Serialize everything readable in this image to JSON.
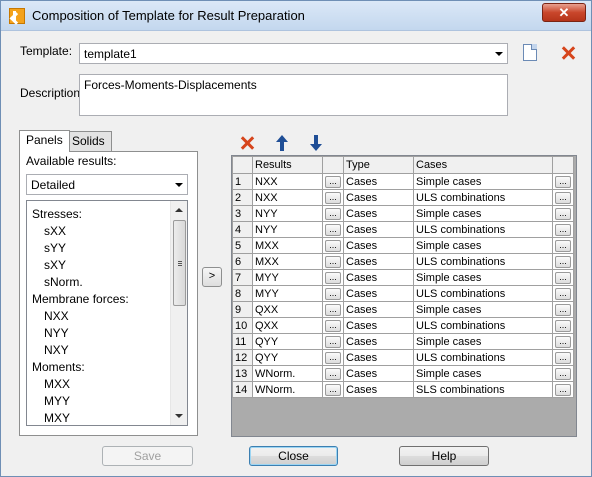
{
  "window": {
    "title": "Composition of Template for Result Preparation",
    "close_label": "✕"
  },
  "template": {
    "label": "Template:",
    "value": "template1"
  },
  "description": {
    "label": "Description:",
    "value": "Forces-Moments-Displacements"
  },
  "tabs": [
    {
      "label": "Panels",
      "active": true
    },
    {
      "label": "Solids",
      "active": false
    }
  ],
  "available": {
    "label": "Available results:",
    "filter_value": "Detailed",
    "items": [
      {
        "text": "Stresses:",
        "indent": 0
      },
      {
        "text": "sXX",
        "indent": 1
      },
      {
        "text": "sYY",
        "indent": 1
      },
      {
        "text": "sXY",
        "indent": 1
      },
      {
        "text": "sNorm.",
        "indent": 1
      },
      {
        "text": "Membrane forces:",
        "indent": 0
      },
      {
        "text": "NXX",
        "indent": 1
      },
      {
        "text": "NYY",
        "indent": 1
      },
      {
        "text": "NXY",
        "indent": 1
      },
      {
        "text": "Moments:",
        "indent": 0
      },
      {
        "text": "MXX",
        "indent": 1
      },
      {
        "text": "MYY",
        "indent": 1
      },
      {
        "text": "MXY",
        "indent": 1
      }
    ]
  },
  "move_button": {
    "label": ">"
  },
  "grid": {
    "headers": [
      "Results",
      "Type",
      "Cases"
    ],
    "ellipsis": "...",
    "rows": [
      [
        "1",
        "NXX",
        "Cases",
        "Simple cases"
      ],
      [
        "2",
        "NXX",
        "Cases",
        "ULS combinations"
      ],
      [
        "3",
        "NYY",
        "Cases",
        "Simple cases"
      ],
      [
        "4",
        "NYY",
        "Cases",
        "ULS combinations"
      ],
      [
        "5",
        "MXX",
        "Cases",
        "Simple cases"
      ],
      [
        "6",
        "MXX",
        "Cases",
        "ULS combinations"
      ],
      [
        "7",
        "MYY",
        "Cases",
        "Simple cases"
      ],
      [
        "8",
        "MYY",
        "Cases",
        "ULS combinations"
      ],
      [
        "9",
        "QXX",
        "Cases",
        "Simple cases"
      ],
      [
        "10",
        "QXX",
        "Cases",
        "ULS combinations"
      ],
      [
        "11",
        "QYY",
        "Cases",
        "Simple cases"
      ],
      [
        "12",
        "QYY",
        "Cases",
        "ULS combinations"
      ],
      [
        "13",
        "WNorm.",
        "Cases",
        "Simple cases"
      ],
      [
        "14",
        "WNorm.",
        "Cases",
        "SLS combinations"
      ]
    ]
  },
  "buttons": {
    "save": "Save",
    "close": "Close",
    "help": "Help"
  },
  "colors": {
    "delete_icon": "#d6451c",
    "arrow_icon": "#1f4e96",
    "titlebar": "#c3d7ee"
  }
}
